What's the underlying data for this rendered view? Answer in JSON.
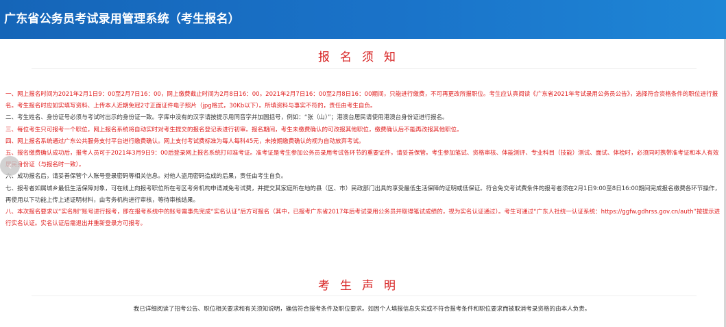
{
  "header": {
    "title": "广东省公务员考试录用管理系统（考生报名）"
  },
  "notice": {
    "title": "报名须知",
    "items": [
      {
        "text": "一、网上报名时间为2021年2月1日9：00至2月7日16：00，网上缴费截止时间为2月8日16：00。2021年2月7日16：00至2月8日16：00期间，只能进行缴费，不可再更改所报职位。考生应认真阅读《广东省2021年考试录用公务员公告》，选择符合资格条件的职位进行报名。考生报名时应如实填写资料、上传本人近期免冠2寸正面证件电子照片（jpg格式，30Kb以下）。所填资料与事实不符的，责任由考生自负。",
        "color": "red"
      },
      {
        "text": "二、考生姓名、身份证号必须与考试时出示的身份证一致。字库中没有的汉字请按提示用同音字并加圆括号，例如：“张（山）”；港澳台居民请使用港澳台身份证进行报名。",
        "color": "dark"
      },
      {
        "text": "三、每位考生只可报考一个职位，网上报名系统将自动实时对考生提交的报名登记表进行初审。报名期间，考生未缴费确认的可改报其他职位，缴费确认后不能再改报其他职位。",
        "color": "red"
      },
      {
        "text": "四、网上报名系统通过广东公共服务支付平台进行缴费确认。网上支付考试费标准为每人每科45元，未按期缴费确认的视为自动放弃考试。",
        "color": "red"
      },
      {
        "text": "五、报名缴费确认成功后，报考人员可于2021年3月9日9：00后登录网上报名系统打印准考证。准考证是考生参加公务员录用考试各环节的重要证件，请妥善保管。考生参加笔试、资格审核、体能测评、专业科目（技能）测试、面试、体检时，必须同时携带准考证和本人有效居民身份证（与报名时一致）。",
        "color": "red"
      },
      {
        "text": "六、成功报名后，请妥善保管个人账号登录密码等相关信息。对他人盗用密码造成的后果，责任由考生自负。",
        "color": "dark"
      },
      {
        "text": "七、报考者如属城乡最低生活保障对象，可在线上向报考职位所在考区考务机构申请减免考试费，并提交其家庭所在地的县（区、市）民政部门出具的享受最低生活保障的证明或低保证。符合免交考试费条件的报考者须在2月1日9:00至8日16:00期间完成报名缴费各环节操作，再使用以下功能上传上述证明材料，由考务机构进行审核，等待审核结果。",
        "color": "dark"
      },
      {
        "text": "八、本次报名要求以“实名制”账号进行报考，即在报考系统中的账号需事先完成“实名认证”后方可报名（其中，已报考广东省2017年后考试录用公务员并取得笔试成绩的，视为实名认证通过）。考生可通过“广东人社统一认证系统：https://ggfw.gdhrss.gov.cn/auth”按提示进行实名认证。实名认证后需退出并重新登录方可报考。",
        "color": "red"
      }
    ]
  },
  "declaration": {
    "title": "考生声明",
    "text": "我已详细阅读了招考公告、职位相关要求和有关须知说明，确信符合报考条件及职位要求。如因个人填报信息失实或不符合报考条件和职位要求而被取消考录资格的由本人负责。"
  },
  "colors": {
    "header": "#1a73c9",
    "accent_red": "#e01d1d",
    "text_dark": "#3a3a3a"
  },
  "icons": {
    "side_handle": "chevron-left-icon"
  }
}
